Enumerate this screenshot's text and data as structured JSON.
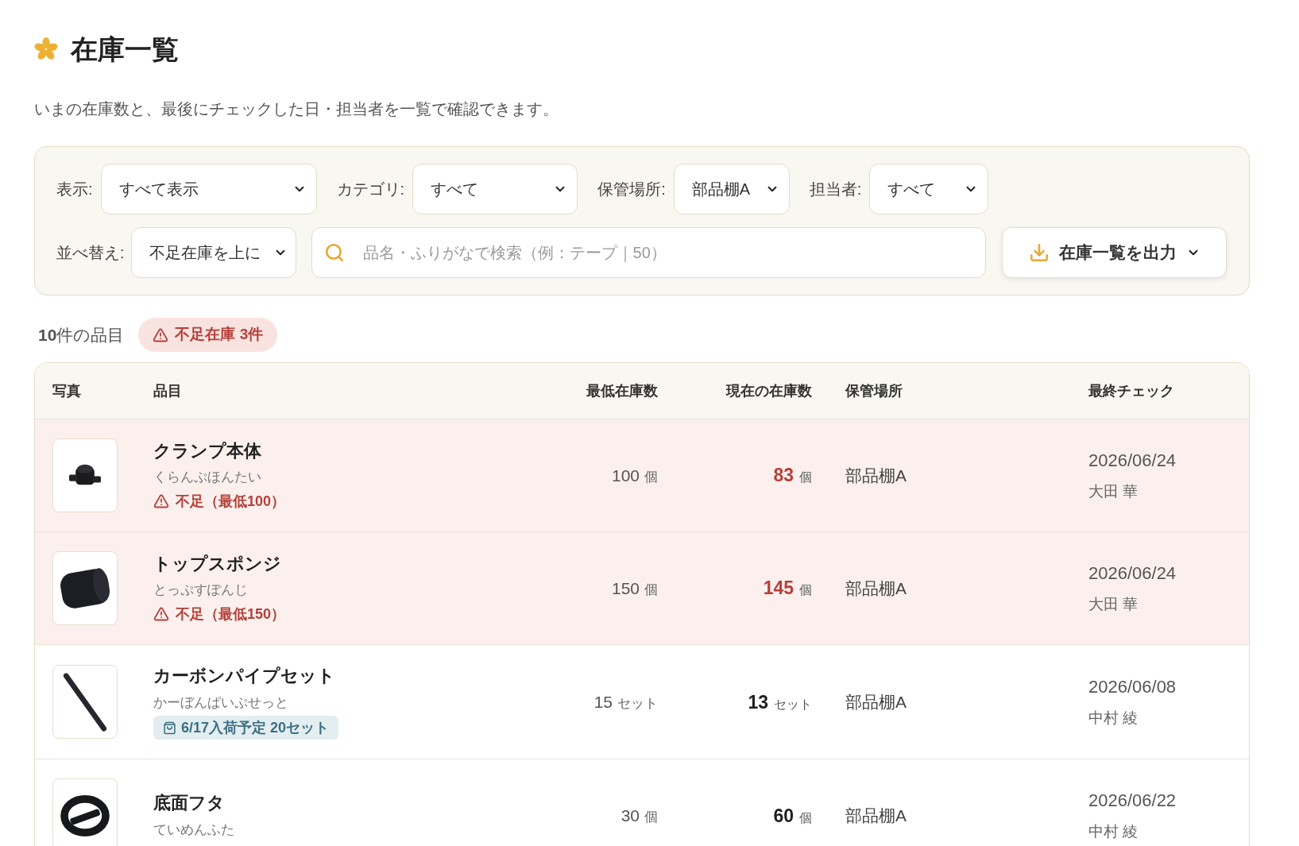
{
  "page": {
    "title": "在庫一覧",
    "subtitle": "いまの在庫数と、最後にチェックした日・担当者を一覧で確認できます。"
  },
  "filters": [
    {
      "label": "表示:",
      "value": "すべて表示"
    },
    {
      "label": "カテゴリ:",
      "value": "すべて"
    },
    {
      "label": "保管場所:",
      "value": "部品棚A"
    },
    {
      "label": "担当者:",
      "value": "すべて"
    }
  ],
  "sort": {
    "label": "並べ替え:",
    "value": "不足在庫を上に"
  },
  "search": {
    "placeholder": "品名・ふりがなで検索（例：テープ｜50）"
  },
  "export_button": {
    "label": "在庫一覧を出力"
  },
  "summary": {
    "count": "**10**件の品目",
    "shortage_badge": "不足在庫 3件"
  },
  "table": {
    "columns": [
      "写真",
      "品目",
      "最低在庫数",
      "現在の在庫数",
      "保管場所",
      "最終チェック"
    ],
    "rows": [
      {
        "photo": {
          "kind": "clamp"
        },
        "name": "クランプ本体",
        "reading": "くらんぷほんたい",
        "short": true,
        "note": {
          "kind": "shortage",
          "text": "不足（最低100）"
        },
        "min": {
          "value": "100",
          "unit": "個"
        },
        "current": {
          "value": "83",
          "unit": "個"
        },
        "location": "部品棚A",
        "checked_on": "2026/06/24",
        "checked_by": "大田 華"
      },
      {
        "photo": {
          "kind": "sponge"
        },
        "name": "トップスポンジ",
        "reading": "とっぷすぽんじ",
        "short": true,
        "note": {
          "kind": "shortage",
          "text": "不足（最低150）"
        },
        "min": {
          "value": "150",
          "unit": "個"
        },
        "current": {
          "value": "145",
          "unit": "個"
        },
        "location": "部品棚A",
        "checked_on": "2026/06/24",
        "checked_by": "大田 華"
      },
      {
        "photo": {
          "kind": "pipe"
        },
        "name": "カーボンパイプセット",
        "reading": "かーぼんぱいぷせっと",
        "short": false,
        "note": {
          "kind": "incoming",
          "text": "6/17入荷予定 20セット"
        },
        "min": {
          "value": "15",
          "unit": "セット"
        },
        "current": {
          "value": "13",
          "unit": "セット"
        },
        "location": "部品棚A",
        "checked_on": "2026/06/08",
        "checked_by": "中村 綾"
      },
      {
        "photo": {
          "kind": "lid"
        },
        "name": "底面フタ",
        "reading": "ていめんふた",
        "short": false,
        "min": {
          "value": "30",
          "unit": "個"
        },
        "current": {
          "value": "60",
          "unit": "個"
        },
        "location": "部品棚A",
        "checked_on": "2026/06/22",
        "checked_by": "中村 綾"
      }
    ]
  }
}
